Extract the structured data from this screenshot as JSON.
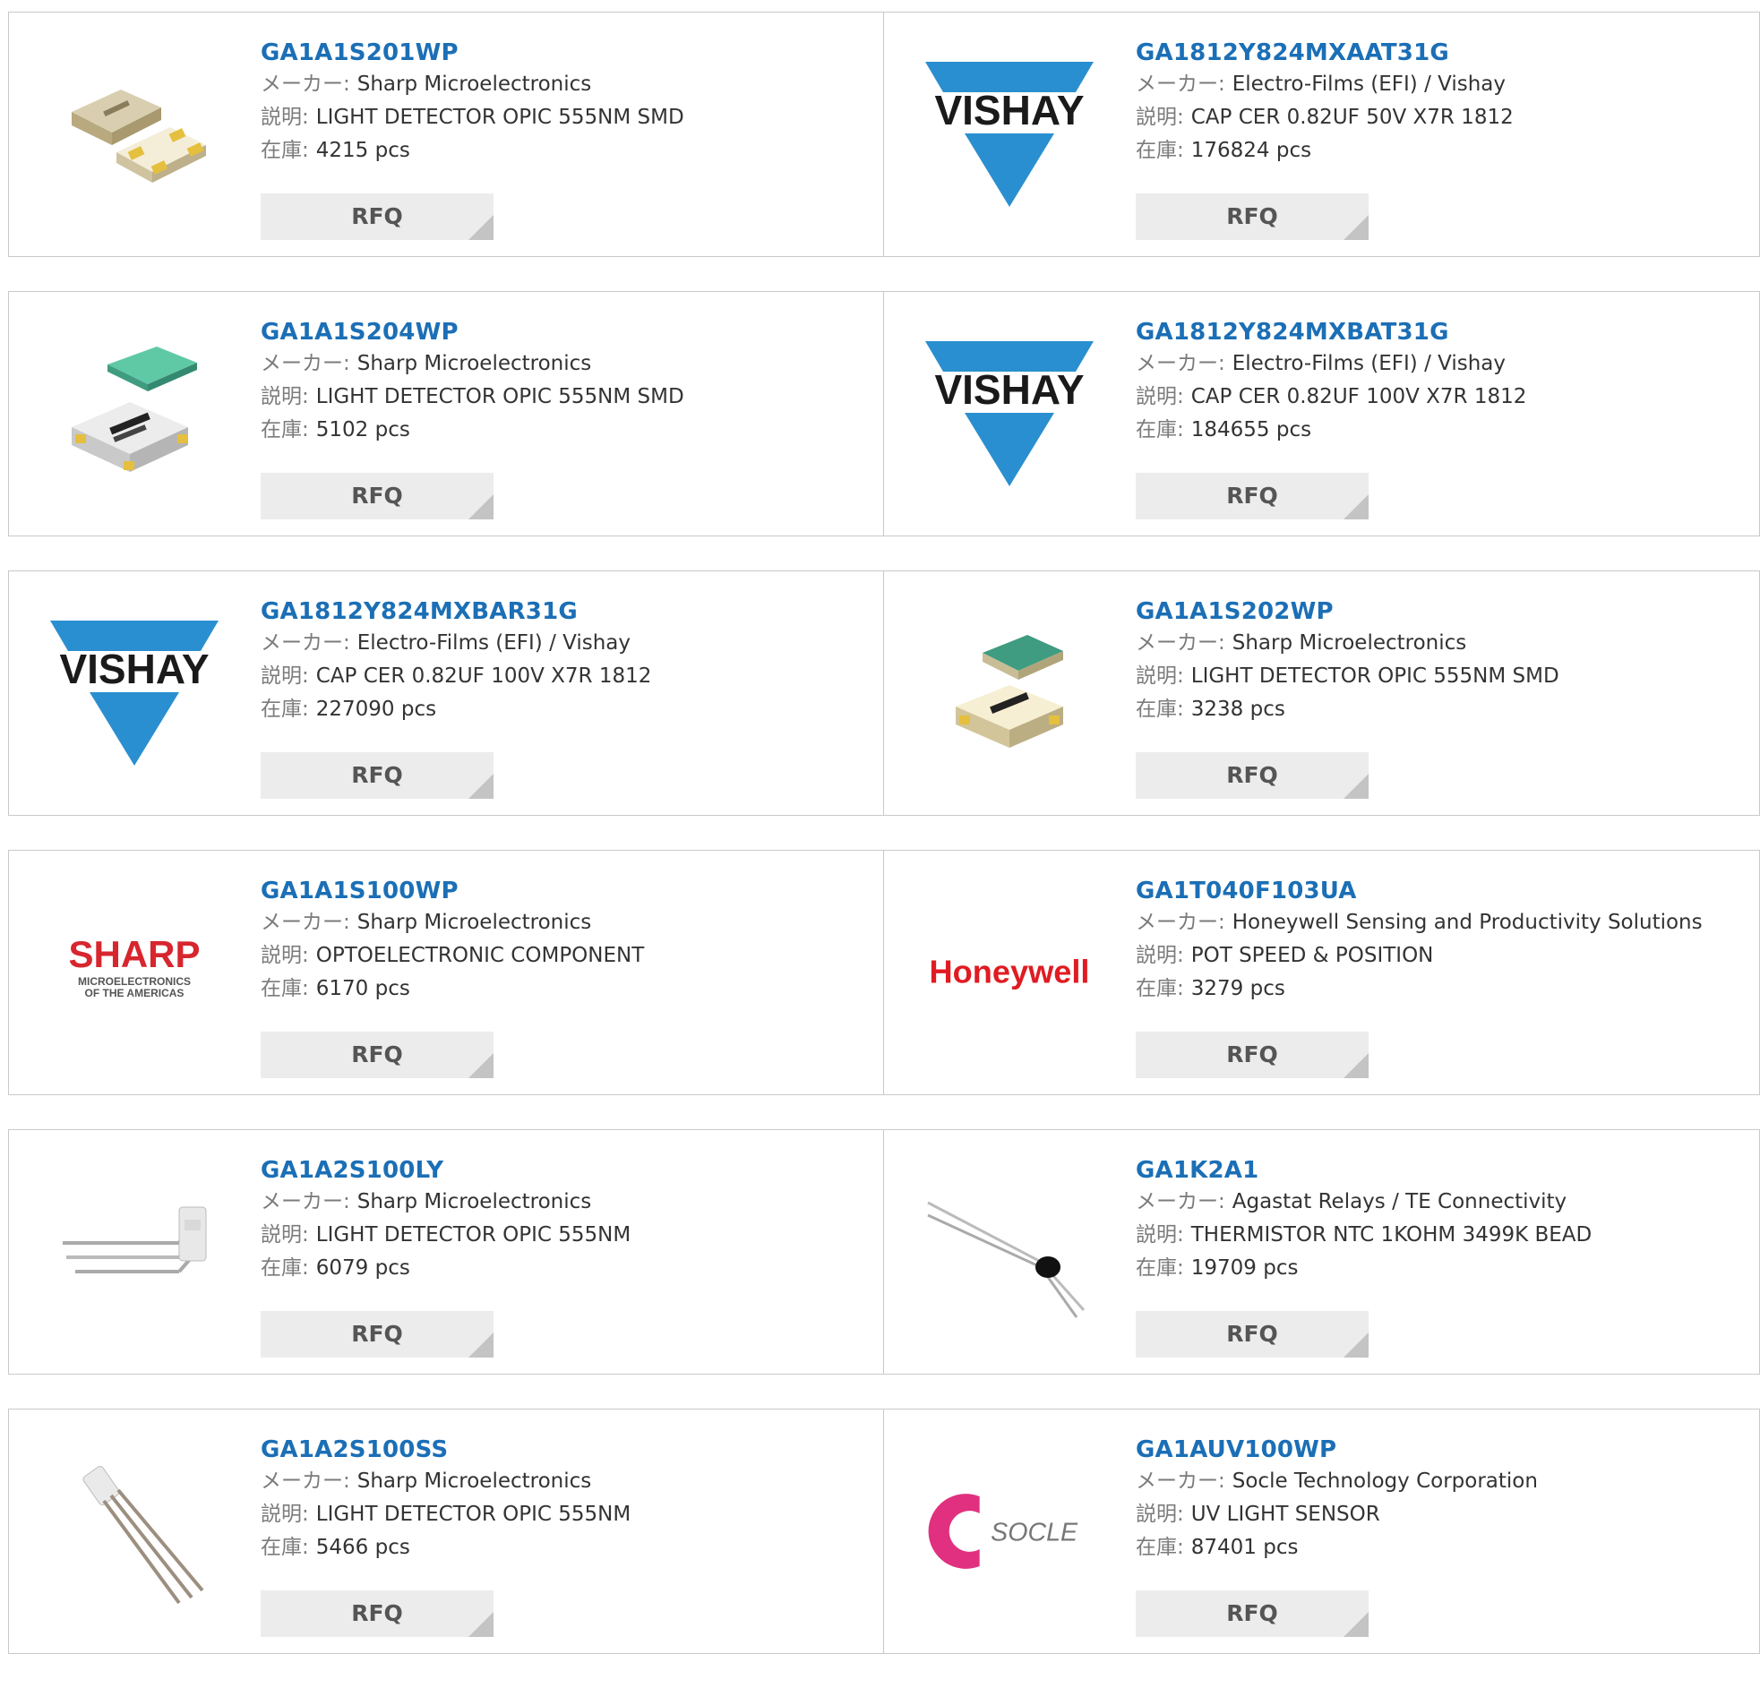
{
  "labels": {
    "maker": "メーカー:",
    "desc": "説明:",
    "stock": "在庫:",
    "rfq": "RFQ"
  },
  "products": [
    {
      "pn": "GA1A1S201WP",
      "maker": "Sharp Microelectronics",
      "desc": "LIGHT DETECTOR OPIC 555NM SMD",
      "stock": "4215 pcs",
      "image": "smd-sensor-image"
    },
    {
      "pn": "GA1812Y824MXAAT31G",
      "maker": "Electro-Films (EFI) / Vishay",
      "desc": "CAP CER 0.82UF 50V X7R 1812",
      "stock": "176824 pcs",
      "image": "vishay-logo"
    },
    {
      "pn": "GA1A1S204WP",
      "maker": "Sharp Microelectronics",
      "desc": "LIGHT DETECTOR OPIC 555NM SMD",
      "stock": "5102 pcs",
      "image": "smd-sensor-image"
    },
    {
      "pn": "GA1812Y824MXBAT31G",
      "maker": "Electro-Films (EFI) / Vishay",
      "desc": "CAP CER 0.82UF 100V X7R 1812",
      "stock": "184655 pcs",
      "image": "vishay-logo"
    },
    {
      "pn": "GA1812Y824MXBAR31G",
      "maker": "Electro-Films (EFI) / Vishay",
      "desc": "CAP CER 0.82UF 100V X7R 1812",
      "stock": "227090 pcs",
      "image": "vishay-logo"
    },
    {
      "pn": "GA1A1S202WP",
      "maker": "Sharp Microelectronics",
      "desc": "LIGHT DETECTOR OPIC 555NM SMD",
      "stock": "3238 pcs",
      "image": "smd-sensor-image"
    },
    {
      "pn": "GA1A1S100WP",
      "maker": "Sharp Microelectronics",
      "desc": "OPTOELECTRONIC COMPONENT",
      "stock": "6170 pcs",
      "image": "sharp-logo"
    },
    {
      "pn": "GA1T040F103UA",
      "maker": "Honeywell Sensing and Productivity Solutions",
      "desc": "POT SPEED & POSITION",
      "stock": "3279 pcs",
      "image": "honeywell-logo"
    },
    {
      "pn": "GA1A2S100LY",
      "maker": "Sharp Microelectronics",
      "desc": "LIGHT DETECTOR OPIC 555NM",
      "stock": "6079 pcs",
      "image": "leaded-sensor-image"
    },
    {
      "pn": "GA1K2A1",
      "maker": "Agastat Relays / TE Connectivity",
      "desc": "THERMISTOR NTC 1KOHM 3499K BEAD",
      "stock": "19709 pcs",
      "image": "thermistor-image"
    },
    {
      "pn": "GA1A2S100SS",
      "maker": "Sharp Microelectronics",
      "desc": "LIGHT DETECTOR OPIC 555NM",
      "stock": "5466 pcs",
      "image": "leaded-sensor-image"
    },
    {
      "pn": "GA1AUV100WP",
      "maker": "Socle Technology Corporation",
      "desc": "UV LIGHT SENSOR",
      "stock": "87401 pcs",
      "image": "socle-logo"
    }
  ],
  "logos": {
    "vishay": "VISHAY",
    "sharp": "SHARP",
    "sharp_sub1": "MICROELECTRONICS",
    "sharp_sub2": "OF THE AMERICAS",
    "honeywell": "Honeywell",
    "socle": "SOCLE"
  },
  "colors": {
    "link": "#1b6fb6",
    "vishay_blue": "#2a8fd0",
    "sharp_red": "#d7262e",
    "honeywell_red": "#e01b22",
    "socle_pink": "#e0307f"
  }
}
